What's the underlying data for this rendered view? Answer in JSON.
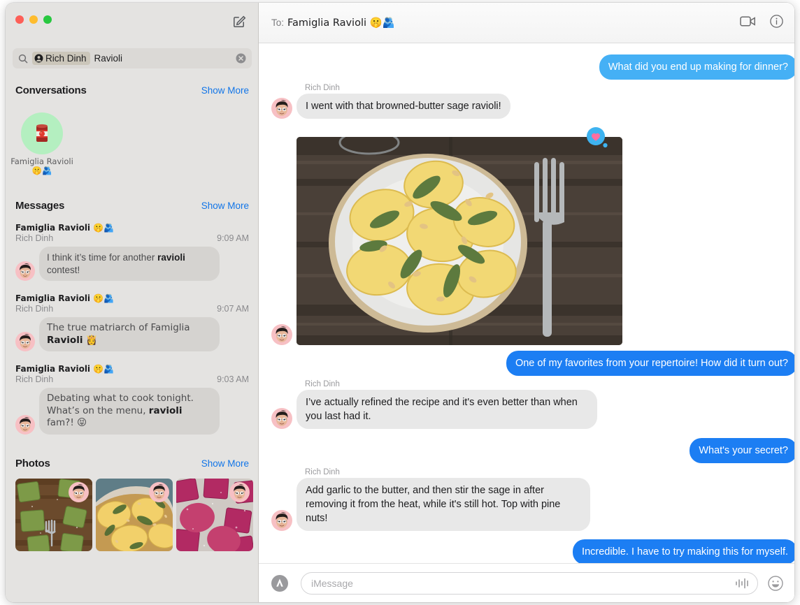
{
  "window": {
    "traffic_lights": [
      "close",
      "minimize",
      "zoom"
    ],
    "compose_icon": "compose-icon"
  },
  "search": {
    "icon": "search-icon",
    "token_icon": "person-circle-icon",
    "token_label": "Rich Dinh",
    "text": "Ravioli",
    "clear_icon": "clear-circle-icon"
  },
  "sidebar": {
    "conversations": {
      "title": "Conversations",
      "show_more": "Show More",
      "items": [
        {
          "name": "Famiglia Ravioli 🤫🫂",
          "avatar_emoji": "🥫",
          "avatar_bg": "#b4efc0"
        }
      ]
    },
    "messages": {
      "title": "Messages",
      "show_more": "Show More",
      "results": [
        {
          "conversation": "Famiglia Ravioli 🤫🫂",
          "sender": "Rich Dinh",
          "time": "9:09 AM",
          "text_before": "I think it’s time for another ",
          "match": "ravioli",
          "text_after": " contest!"
        },
        {
          "conversation": "Famiglia Ravioli 🤫🫂",
          "sender": "Rich Dinh",
          "time": "9:07 AM",
          "text_before": "The true matriarch of Famiglia ",
          "match": "Ravioli",
          "text_after": " 👸"
        },
        {
          "conversation": "Famiglia Ravioli 🤫🫂",
          "sender": "Rich Dinh",
          "time": "9:03 AM",
          "text_before": "Debating what to cook tonight. What’s on the menu, ",
          "match": "ravioli",
          "text_after": " fam?! 😝"
        }
      ]
    },
    "photos": {
      "title": "Photos",
      "show_more": "Show More",
      "items": [
        {
          "alt": "green-spinach-ravioli-on-wood-board-with-fork"
        },
        {
          "alt": "yellow-ravioli-with-sage-and-pine-nuts"
        },
        {
          "alt": "pink-beet-ravioli-dusted-with-flour"
        }
      ]
    }
  },
  "conversation": {
    "to_label": "To:",
    "title": "Famiglia Ravioli 🤫🫂",
    "facetime_icon": "video-camera-icon",
    "info_icon": "info-circle-icon",
    "messages": [
      {
        "direction": "outgoing",
        "text": "What did you end up making for dinner?",
        "style": "light"
      },
      {
        "direction": "incoming",
        "sender": "Rich Dinh",
        "text": "I went with that browned-butter sage ravioli!"
      },
      {
        "direction": "incoming",
        "sender": "Rich Dinh",
        "type": "photo",
        "alt": "plate-of-browned-butter-sage-ravioli-with-pine-nuts-on-dark-wood-table-with-fork",
        "tapback": "heart"
      },
      {
        "direction": "outgoing",
        "text": "One of my favorites from your repertoire! How did it turn out?"
      },
      {
        "direction": "incoming",
        "sender": "Rich Dinh",
        "text": "I’ve actually refined the recipe and it's even better than when you last had it."
      },
      {
        "direction": "outgoing",
        "text": "What's your secret?"
      },
      {
        "direction": "incoming",
        "sender": "Rich Dinh",
        "text": "Add garlic to the butter, and then stir the sage in after removing it from the heat, while it's still hot. Top with pine nuts!"
      },
      {
        "direction": "outgoing",
        "text": "Incredible. I have to try making this for myself."
      }
    ]
  },
  "composer": {
    "apps_icon": "app-store-icon",
    "placeholder": "iMessage",
    "value": "",
    "audio_icon": "audio-waveform-icon",
    "emoji_icon": "emoji-smiley-icon"
  },
  "colors": {
    "accent_blue": "#1c7ef3",
    "accent_blue_light": "#45b0f5",
    "bubble_gray": "#e8e8e8",
    "sidebar_bg": "#e4e3e1",
    "link_blue": "#1175e8"
  }
}
